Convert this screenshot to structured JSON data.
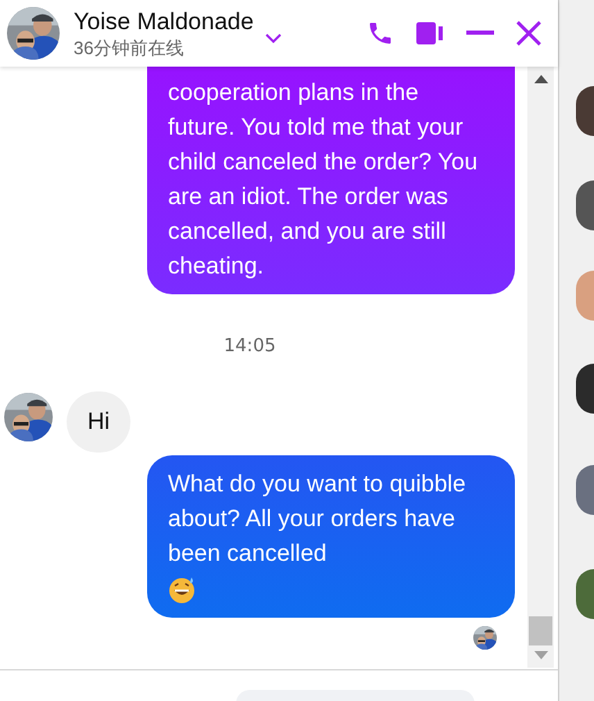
{
  "header": {
    "name": "Yoise Maldonade",
    "status": "36分钟前在线"
  },
  "messages": [
    {
      "kind": "sent",
      "text": "cooperation plans in the future. You told me that your child canceled the order? You are an idiot. The order was cancelled, and you are still cheating.",
      "color": "#9a10ff"
    },
    {
      "kind": "time",
      "text": "14:05"
    },
    {
      "kind": "received",
      "text": "Hi"
    },
    {
      "kind": "sent",
      "text": "What do you want to quibble about? All your orders have been cancelled",
      "emoji": true,
      "color": "#2456f2"
    }
  ]
}
